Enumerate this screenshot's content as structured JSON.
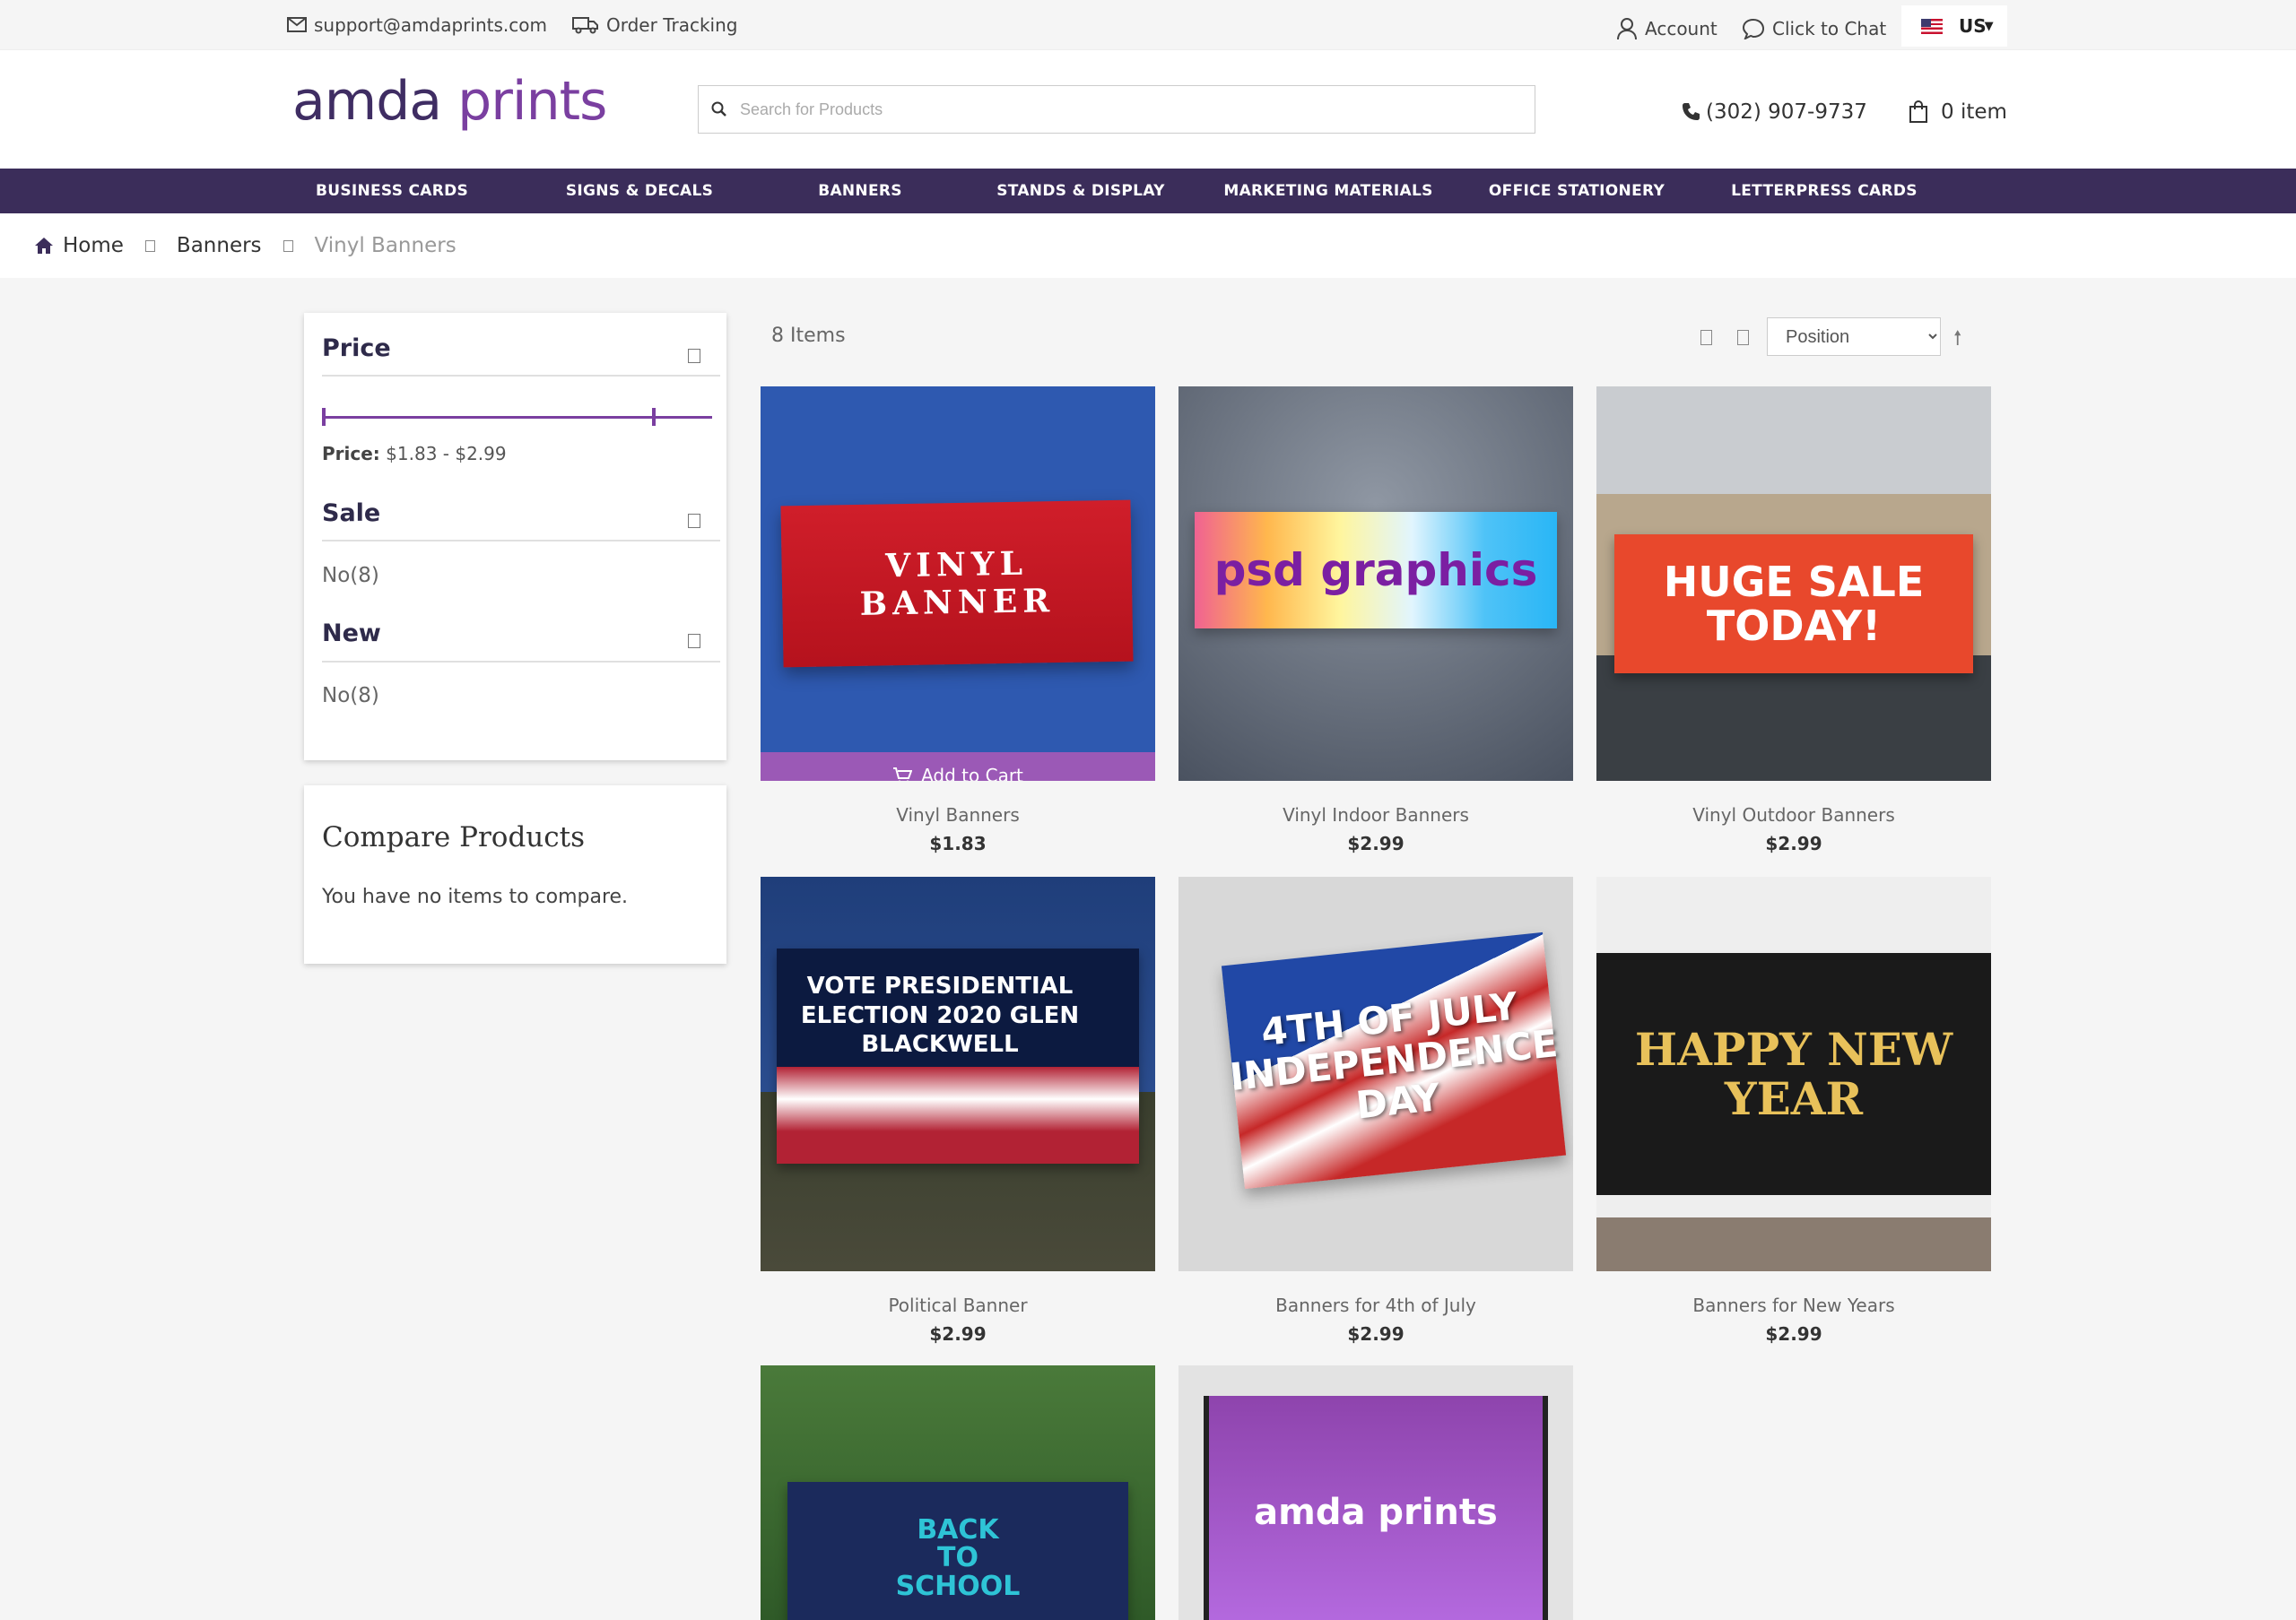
{
  "topbar": {
    "email": "support@amdaprints.com",
    "order_tracking": "Order Tracking",
    "account": "Account",
    "chat": "Click to Chat",
    "locale": "US"
  },
  "header": {
    "logo_part1": "amda",
    "logo_part2": "prints",
    "search_placeholder": "Search for Products",
    "phone": "(302) 907-9737",
    "cart": "0 item"
  },
  "nav": [
    "BUSINESS CARDS",
    "SIGNS & DECALS",
    "BANNERS",
    "STANDS & DISPLAY",
    "MARKETING MATERIALS",
    "OFFICE STATIONERY",
    "LETTERPRESS CARDS"
  ],
  "breadcrumb": {
    "home": "Home",
    "banners": "Banners",
    "current": "Vinyl Banners"
  },
  "filters": {
    "price_title": "Price",
    "price_label": "Price:",
    "price_range": "$1.83 - $2.99",
    "sale_title": "Sale",
    "sale_option": "No(8)",
    "new_title": "New",
    "new_option": "No(8)"
  },
  "compare": {
    "title": "Compare Products",
    "text": "You have no items to compare."
  },
  "toolbar": {
    "count": "8 Items",
    "sort": "Position"
  },
  "add_to_cart": "Add to Cart",
  "products": [
    {
      "name": "Vinyl Banners",
      "price": "$1.83",
      "art": "VINYL BANNER"
    },
    {
      "name": "Vinyl Indoor Banners",
      "price": "$2.99",
      "art": "psd graphics"
    },
    {
      "name": "Vinyl Outdoor Banners",
      "price": "$2.99",
      "art": "HUGE SALE TODAY!"
    },
    {
      "name": "Political Banner",
      "price": "$2.99",
      "art": "VOTE PRESIDENTIAL ELECTION 2020 GLEN BLACKWELL"
    },
    {
      "name": "Banners for 4th of July",
      "price": "$2.99",
      "art": "4TH OF JULY INDEPENDENCE DAY"
    },
    {
      "name": "Banners for New Years",
      "price": "$2.99",
      "art": "HAPPY NEW YEAR"
    },
    {
      "name": "",
      "price": "",
      "art": "BACK TO SCHOOL"
    },
    {
      "name": "",
      "price": "",
      "art": "amda prints"
    }
  ],
  "colors": {
    "brand_dark": "#3b2d5a",
    "brand_purple": "#7a3fa0",
    "cart_button": "#9b59b6"
  }
}
